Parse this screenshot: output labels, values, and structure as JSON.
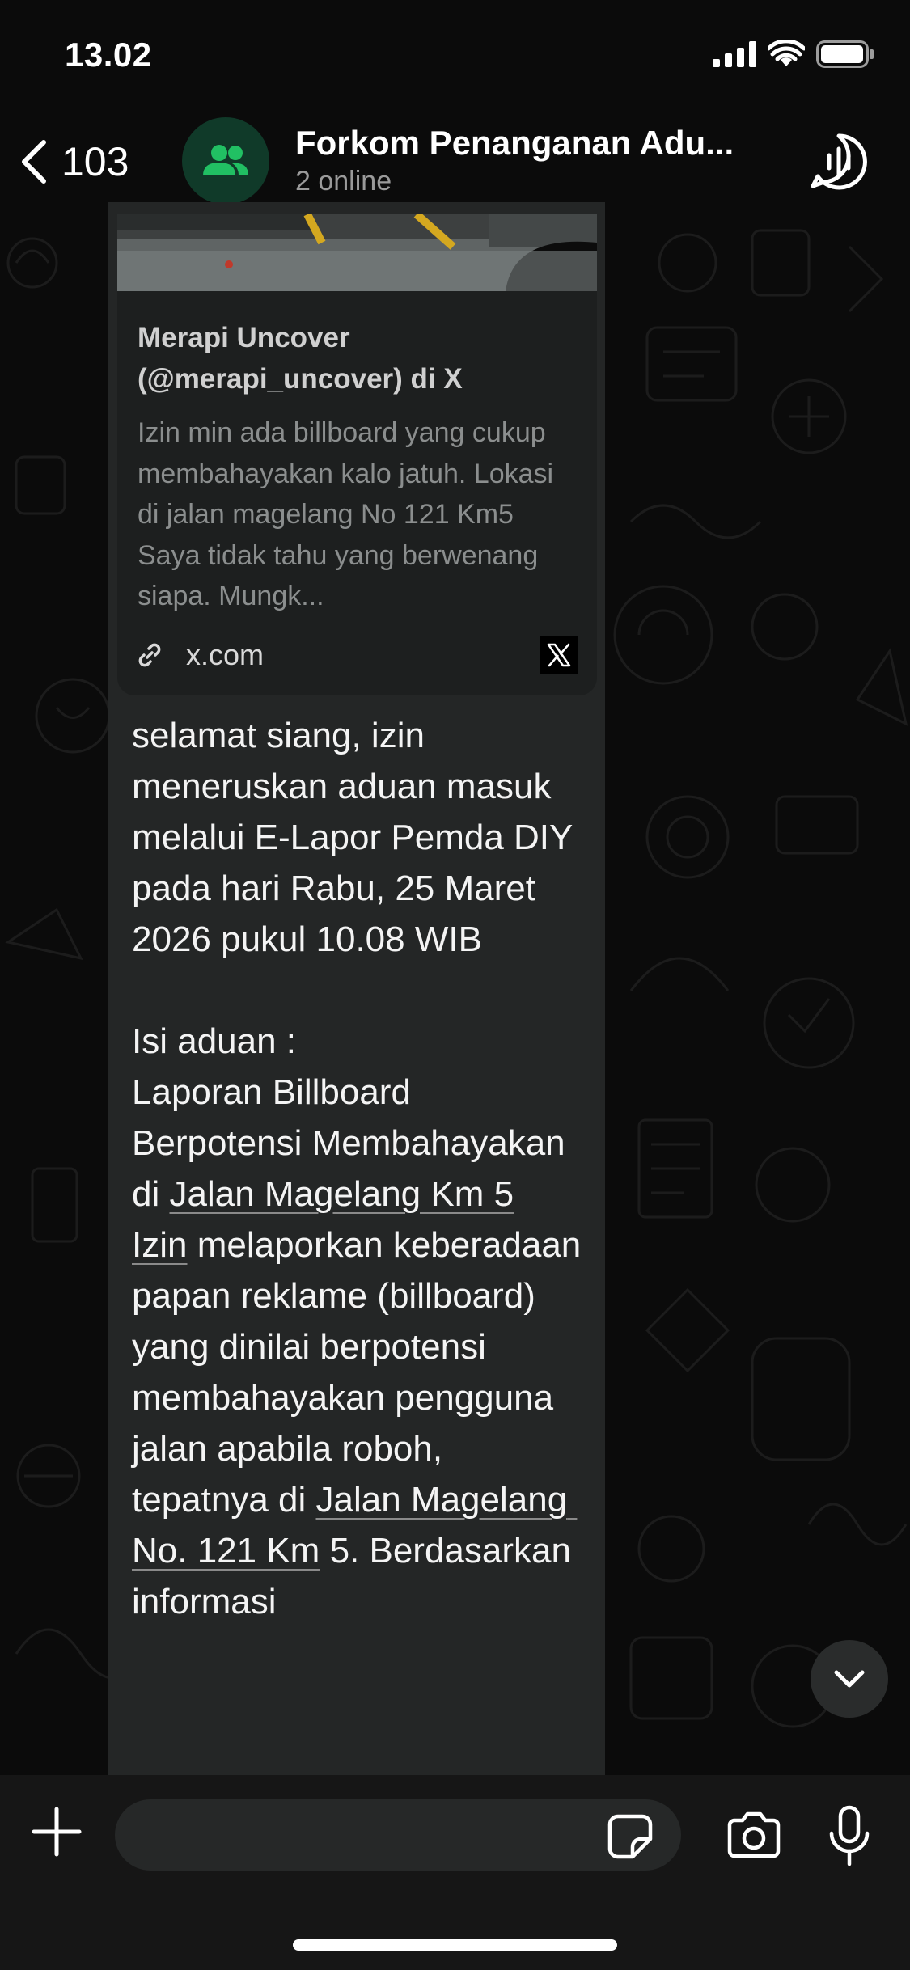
{
  "status_bar": {
    "time": "13.02",
    "icons": [
      "cellular-signal-icon",
      "wifi-icon",
      "battery-icon"
    ]
  },
  "header": {
    "back_count": "103",
    "title": "Forkom Penanganan Adu...",
    "subtitle": "2 online",
    "avatar_icon": "group-icon",
    "action_icon": "voice-chat-icon"
  },
  "message": {
    "link_preview": {
      "title": "Merapi Uncover (@merapi_uncover) di X",
      "description": "Izin min ada billboard yang cukup membahayakan kalo jatuh. Lokasi di jalan magelang No 121 Km5 Saya tidak tahu yang berwenang siapa. Mungk...",
      "domain": "x.com",
      "icons": [
        "link-icon",
        "x-logo-icon"
      ]
    },
    "intro": "selamat siang, izin meneruskan aduan masuk melalui E-Lapor Pemda DIY pada hari Rabu, 25 Maret 2026 pukul 10.08 WIB",
    "label": "Isi aduan :",
    "body_1": "Laporan Billboard Berpotensi Membahayakan di ",
    "link_1": "Jalan Magelang Km 5",
    "link_2": "Izin",
    "body_2": " melaporkan keberadaan papan reklame (billboard) yang dinilai berpotensi membahayakan pengguna jalan apabila roboh, tepatnya di ",
    "link_3": "Jalan Magelang No. 121 Km",
    "body_3": " 5. Berdasarkan informasi"
  },
  "composer": {
    "placeholder": "",
    "icons": [
      "plus-icon",
      "sticker-icon",
      "camera-icon",
      "microphone-icon"
    ]
  },
  "colors": {
    "background": "#0b0b0b",
    "bubble": "#242626",
    "accent_green": "#21c063",
    "avatar_bg": "#103a29"
  }
}
